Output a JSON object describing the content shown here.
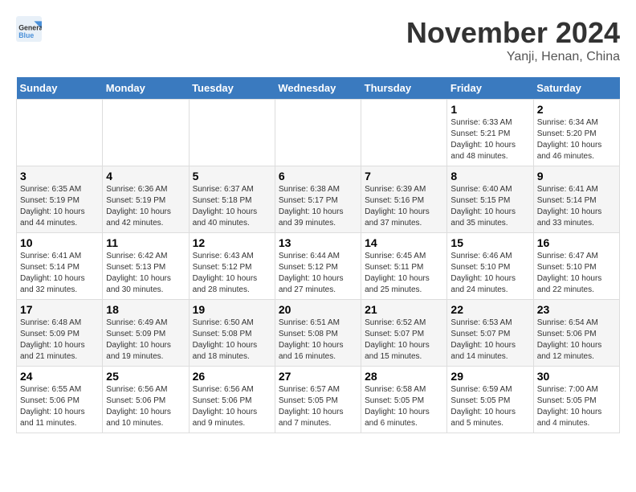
{
  "header": {
    "logo_line1": "General",
    "logo_line2": "Blue",
    "month": "November 2024",
    "location": "Yanji, Henan, China"
  },
  "weekdays": [
    "Sunday",
    "Monday",
    "Tuesday",
    "Wednesday",
    "Thursday",
    "Friday",
    "Saturday"
  ],
  "weeks": [
    [
      {
        "day": "",
        "info": ""
      },
      {
        "day": "",
        "info": ""
      },
      {
        "day": "",
        "info": ""
      },
      {
        "day": "",
        "info": ""
      },
      {
        "day": "",
        "info": ""
      },
      {
        "day": "1",
        "info": "Sunrise: 6:33 AM\nSunset: 5:21 PM\nDaylight: 10 hours and 48 minutes."
      },
      {
        "day": "2",
        "info": "Sunrise: 6:34 AM\nSunset: 5:20 PM\nDaylight: 10 hours and 46 minutes."
      }
    ],
    [
      {
        "day": "3",
        "info": "Sunrise: 6:35 AM\nSunset: 5:19 PM\nDaylight: 10 hours and 44 minutes."
      },
      {
        "day": "4",
        "info": "Sunrise: 6:36 AM\nSunset: 5:19 PM\nDaylight: 10 hours and 42 minutes."
      },
      {
        "day": "5",
        "info": "Sunrise: 6:37 AM\nSunset: 5:18 PM\nDaylight: 10 hours and 40 minutes."
      },
      {
        "day": "6",
        "info": "Sunrise: 6:38 AM\nSunset: 5:17 PM\nDaylight: 10 hours and 39 minutes."
      },
      {
        "day": "7",
        "info": "Sunrise: 6:39 AM\nSunset: 5:16 PM\nDaylight: 10 hours and 37 minutes."
      },
      {
        "day": "8",
        "info": "Sunrise: 6:40 AM\nSunset: 5:15 PM\nDaylight: 10 hours and 35 minutes."
      },
      {
        "day": "9",
        "info": "Sunrise: 6:41 AM\nSunset: 5:14 PM\nDaylight: 10 hours and 33 minutes."
      }
    ],
    [
      {
        "day": "10",
        "info": "Sunrise: 6:41 AM\nSunset: 5:14 PM\nDaylight: 10 hours and 32 minutes."
      },
      {
        "day": "11",
        "info": "Sunrise: 6:42 AM\nSunset: 5:13 PM\nDaylight: 10 hours and 30 minutes."
      },
      {
        "day": "12",
        "info": "Sunrise: 6:43 AM\nSunset: 5:12 PM\nDaylight: 10 hours and 28 minutes."
      },
      {
        "day": "13",
        "info": "Sunrise: 6:44 AM\nSunset: 5:12 PM\nDaylight: 10 hours and 27 minutes."
      },
      {
        "day": "14",
        "info": "Sunrise: 6:45 AM\nSunset: 5:11 PM\nDaylight: 10 hours and 25 minutes."
      },
      {
        "day": "15",
        "info": "Sunrise: 6:46 AM\nSunset: 5:10 PM\nDaylight: 10 hours and 24 minutes."
      },
      {
        "day": "16",
        "info": "Sunrise: 6:47 AM\nSunset: 5:10 PM\nDaylight: 10 hours and 22 minutes."
      }
    ],
    [
      {
        "day": "17",
        "info": "Sunrise: 6:48 AM\nSunset: 5:09 PM\nDaylight: 10 hours and 21 minutes."
      },
      {
        "day": "18",
        "info": "Sunrise: 6:49 AM\nSunset: 5:09 PM\nDaylight: 10 hours and 19 minutes."
      },
      {
        "day": "19",
        "info": "Sunrise: 6:50 AM\nSunset: 5:08 PM\nDaylight: 10 hours and 18 minutes."
      },
      {
        "day": "20",
        "info": "Sunrise: 6:51 AM\nSunset: 5:08 PM\nDaylight: 10 hours and 16 minutes."
      },
      {
        "day": "21",
        "info": "Sunrise: 6:52 AM\nSunset: 5:07 PM\nDaylight: 10 hours and 15 minutes."
      },
      {
        "day": "22",
        "info": "Sunrise: 6:53 AM\nSunset: 5:07 PM\nDaylight: 10 hours and 14 minutes."
      },
      {
        "day": "23",
        "info": "Sunrise: 6:54 AM\nSunset: 5:06 PM\nDaylight: 10 hours and 12 minutes."
      }
    ],
    [
      {
        "day": "24",
        "info": "Sunrise: 6:55 AM\nSunset: 5:06 PM\nDaylight: 10 hours and 11 minutes."
      },
      {
        "day": "25",
        "info": "Sunrise: 6:56 AM\nSunset: 5:06 PM\nDaylight: 10 hours and 10 minutes."
      },
      {
        "day": "26",
        "info": "Sunrise: 6:56 AM\nSunset: 5:06 PM\nDaylight: 10 hours and 9 minutes."
      },
      {
        "day": "27",
        "info": "Sunrise: 6:57 AM\nSunset: 5:05 PM\nDaylight: 10 hours and 7 minutes."
      },
      {
        "day": "28",
        "info": "Sunrise: 6:58 AM\nSunset: 5:05 PM\nDaylight: 10 hours and 6 minutes."
      },
      {
        "day": "29",
        "info": "Sunrise: 6:59 AM\nSunset: 5:05 PM\nDaylight: 10 hours and 5 minutes."
      },
      {
        "day": "30",
        "info": "Sunrise: 7:00 AM\nSunset: 5:05 PM\nDaylight: 10 hours and 4 minutes."
      }
    ]
  ]
}
